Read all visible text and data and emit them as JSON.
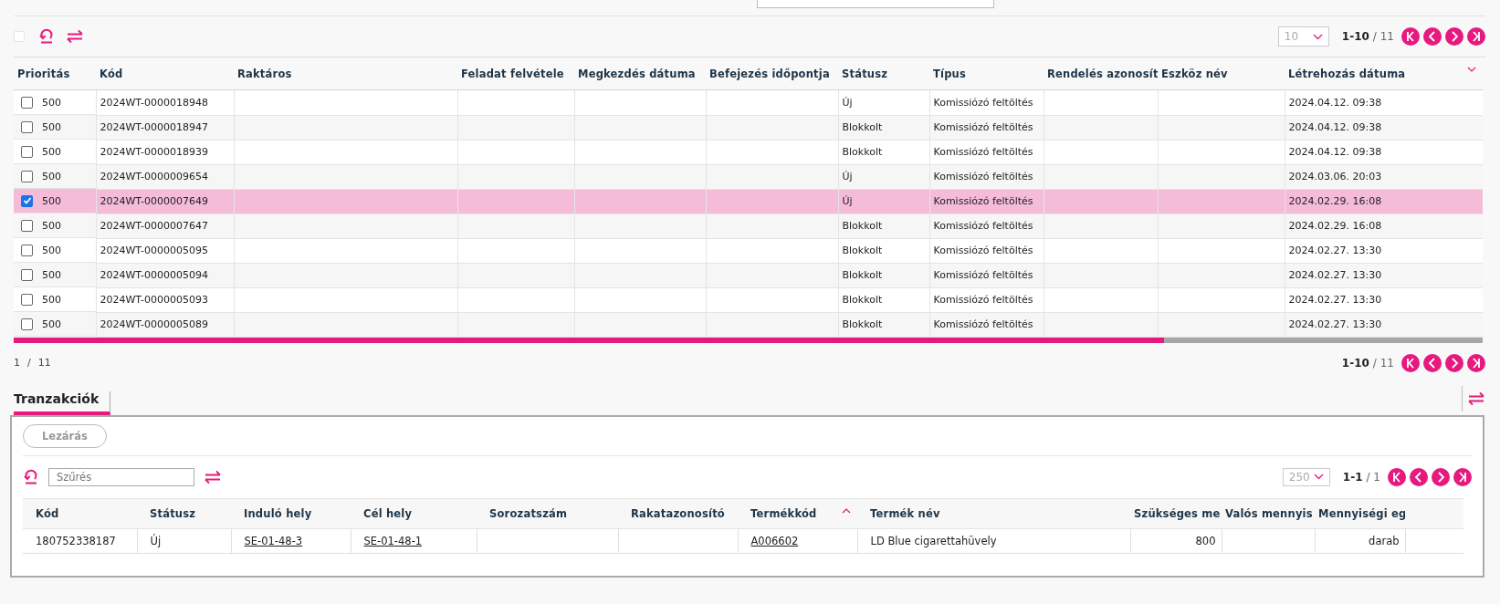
{
  "toolbar": {
    "select_all": {
      "checked": false
    }
  },
  "pager_top": {
    "page_size": "10",
    "range": "1-10",
    "total": "/ 11"
  },
  "table": {
    "columns": [
      {
        "label": "Prioritás"
      },
      {
        "label": "Kód"
      },
      {
        "label": "Raktáros"
      },
      {
        "label": "Feladat felvétele"
      },
      {
        "label": "Megkezdés dátuma"
      },
      {
        "label": "Befejezés időpontja"
      },
      {
        "label": "Státusz"
      },
      {
        "label": "Típus"
      },
      {
        "label": "Rendelés azonosít"
      },
      {
        "label": "Eszköz név"
      },
      {
        "label": "Létrehozás dátuma",
        "sorted": true,
        "descending": true
      }
    ],
    "rows": [
      {
        "selected": false,
        "cells": [
          "500",
          "2024WT-0000018948",
          null,
          null,
          null,
          null,
          "Új",
          "Komissiózó feltöltés",
          null,
          null,
          "2024.04.12. 09:38"
        ]
      },
      {
        "selected": false,
        "cells": [
          "500",
          "2024WT-0000018947",
          null,
          null,
          null,
          null,
          "Blokkolt",
          "Komissiózó feltöltés",
          null,
          null,
          "2024.04.12. 09:38"
        ]
      },
      {
        "selected": false,
        "cells": [
          "500",
          "2024WT-0000018939",
          null,
          null,
          null,
          null,
          "Blokkolt",
          "Komissiózó feltöltés",
          null,
          null,
          "2024.04.12. 09:38"
        ]
      },
      {
        "selected": false,
        "cells": [
          "500",
          "2024WT-0000009654",
          null,
          null,
          null,
          null,
          "Új",
          "Komissiózó feltöltés",
          null,
          null,
          "2024.03.06. 20:03"
        ]
      },
      {
        "selected": true,
        "cells": [
          "500",
          "2024WT-0000007649",
          null,
          null,
          null,
          null,
          "Új",
          "Komissiózó feltöltés",
          null,
          null,
          "2024.02.29. 16:08"
        ]
      },
      {
        "selected": false,
        "cells": [
          "500",
          "2024WT-0000007647",
          null,
          null,
          null,
          null,
          "Blokkolt",
          "Komissiózó feltöltés",
          null,
          null,
          "2024.02.29. 16:08"
        ]
      },
      {
        "selected": false,
        "cells": [
          "500",
          "2024WT-0000005095",
          null,
          null,
          null,
          null,
          "Blokkolt",
          "Komissiózó feltöltés",
          null,
          null,
          "2024.02.27. 13:30"
        ]
      },
      {
        "selected": false,
        "cells": [
          "500",
          "2024WT-0000005094",
          null,
          null,
          null,
          null,
          "Blokkolt",
          "Komissiózó feltöltés",
          null,
          null,
          "2024.02.27. 13:30"
        ]
      },
      {
        "selected": false,
        "cells": [
          "500",
          "2024WT-0000005093",
          null,
          null,
          null,
          null,
          "Blokkolt",
          "Komissiózó feltöltés",
          null,
          null,
          "2024.02.27. 13:30"
        ]
      },
      {
        "selected": false,
        "cells": [
          "500",
          "2024WT-0000005089",
          null,
          null,
          null,
          null,
          "Blokkolt",
          "Komissiózó feltöltés",
          null,
          null,
          "2024.02.27. 13:30"
        ]
      }
    ]
  },
  "page_indicator": {
    "current": "1",
    "separator": "/",
    "total": "11"
  },
  "pager_bottom": {
    "range": "1-10",
    "total": "/ 11"
  },
  "tabs": [
    {
      "label": "Tranzakciók",
      "selected": true
    }
  ],
  "transactions": {
    "close_button": "Lezárás",
    "filter": {
      "placeholder": "Szűrés"
    },
    "pager": {
      "page_size": "250",
      "range": "1-1",
      "total": "/ 1"
    },
    "columns": [
      {
        "label": "Kód"
      },
      {
        "label": "Státusz"
      },
      {
        "label": "Induló hely"
      },
      {
        "label": "Cél hely"
      },
      {
        "label": "Sorozatszám"
      },
      {
        "label": "Rakatazonosító"
      },
      {
        "label": "Termékkód",
        "sorted": true,
        "descending": false
      },
      {
        "label": "Termék név"
      },
      {
        "label": "Szükséges me"
      },
      {
        "label": "Valós mennyis"
      },
      {
        "label": "Mennyiségi eg"
      }
    ],
    "rows": [
      {
        "cells": [
          {
            "kind": "text",
            "text": "180752338187"
          },
          {
            "kind": "text",
            "text": "Új"
          },
          {
            "kind": "link",
            "text": "SE-01-48-3"
          },
          {
            "kind": "link",
            "text": "SE-01-48-1"
          },
          null,
          null,
          {
            "kind": "link",
            "text": "A006602"
          },
          {
            "kind": "text",
            "text": "LD Blue cigarettahüvely"
          },
          {
            "kind": "number",
            "text": "800"
          },
          null,
          {
            "kind": "number",
            "text": "darab"
          }
        ]
      }
    ]
  }
}
